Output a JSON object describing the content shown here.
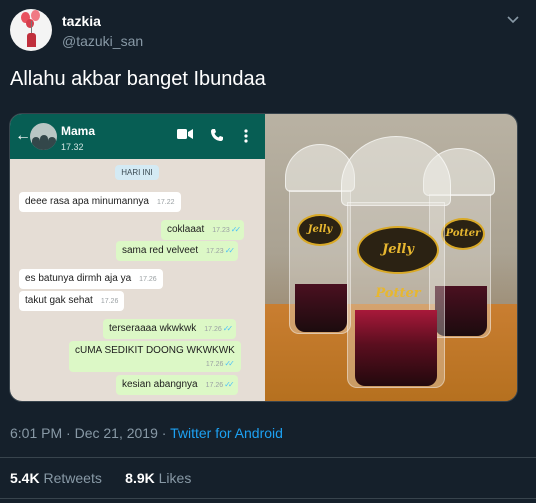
{
  "user": {
    "name": "tazkia",
    "handle": "@tazuki_san"
  },
  "tweet": {
    "text": "Allahu akbar banget Ibundaa"
  },
  "chat": {
    "contact": "Mama",
    "last_seen": "17.32",
    "day_label": "HARI INI",
    "messages": [
      {
        "dir": "in",
        "text": "deee rasa apa minumannya",
        "time": "17.22"
      },
      {
        "dir": "out",
        "text": "coklaaat",
        "time": "17.23"
      },
      {
        "dir": "out",
        "text": "sama red velveet",
        "time": "17.23"
      },
      {
        "dir": "in",
        "text": "es batunya dirmh aja ya",
        "time": "17.26"
      },
      {
        "dir": "in",
        "text": "takut gak sehat",
        "time": "17.26"
      },
      {
        "dir": "out",
        "text": "terseraaaa wkwkwk",
        "time": "17.26"
      },
      {
        "dir": "out",
        "text": "cUMA SEDIKIT DOONG WKWKWK",
        "time": "17.26"
      },
      {
        "dir": "out",
        "text": "kesian abangnya",
        "time": "17.26"
      }
    ]
  },
  "photo": {
    "brand": "Jelly Potter",
    "brand_words": [
      "Jelly",
      "Potter"
    ]
  },
  "meta": {
    "time": "6:01 PM",
    "separator": " · ",
    "date": "Dec 21, 2019",
    "source": "Twitter for Android"
  },
  "stats": {
    "retweets_count": "5.4K",
    "retweets_label": "Retweets",
    "likes_count": "8.9K",
    "likes_label": "Likes"
  },
  "icons": [
    "avatar-balloon-icon",
    "chevron-down-icon",
    "back-arrow-icon",
    "video-call-icon",
    "phone-icon",
    "more-vertical-icon",
    "read-receipt-icon"
  ],
  "colors": {
    "background": "#15202b",
    "text_secondary": "#8899a6",
    "link": "#1da1f2",
    "whatsapp_header": "#075e54",
    "outgoing_bubble": "#dcf8c6",
    "incoming_bubble": "#ffffff",
    "chat_background": "#e5ddd5"
  }
}
